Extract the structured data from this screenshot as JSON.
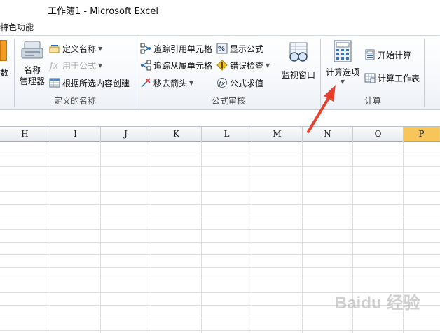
{
  "window": {
    "title": "工作簿1  -  Microsoft Excel"
  },
  "ribbon_tab": "特色功能",
  "left_partial_button": "数",
  "groups": {
    "defined_names": {
      "label": "定义的名称",
      "name_manager": "名称\n管理器",
      "define_name": "定义名称",
      "use_in_formula": "用于公式",
      "create_from_selection": "根据所选内容创建"
    },
    "formula_auditing": {
      "label": "公式审核",
      "trace_precedents": "追踪引用单元格",
      "trace_dependents": "追踪从属单元格",
      "remove_arrows": "移去箭头",
      "show_formulas": "显示公式",
      "error_checking": "错误检查",
      "evaluate_formula": "公式求值",
      "watch_window": "监视窗口"
    },
    "calculation": {
      "label": "计算",
      "calc_options": "计算选项",
      "calc_now": "开始计算",
      "calc_sheet": "计算工作表"
    }
  },
  "columns": [
    "H",
    "I",
    "J",
    "K",
    "L",
    "M",
    "N",
    "O",
    "P"
  ],
  "selected_column": "P",
  "watermark": "Baidu 经验",
  "colors": {
    "selected_header": "#f7c65b",
    "arrow": "#e8402f",
    "accent": "#1f5fa8"
  }
}
